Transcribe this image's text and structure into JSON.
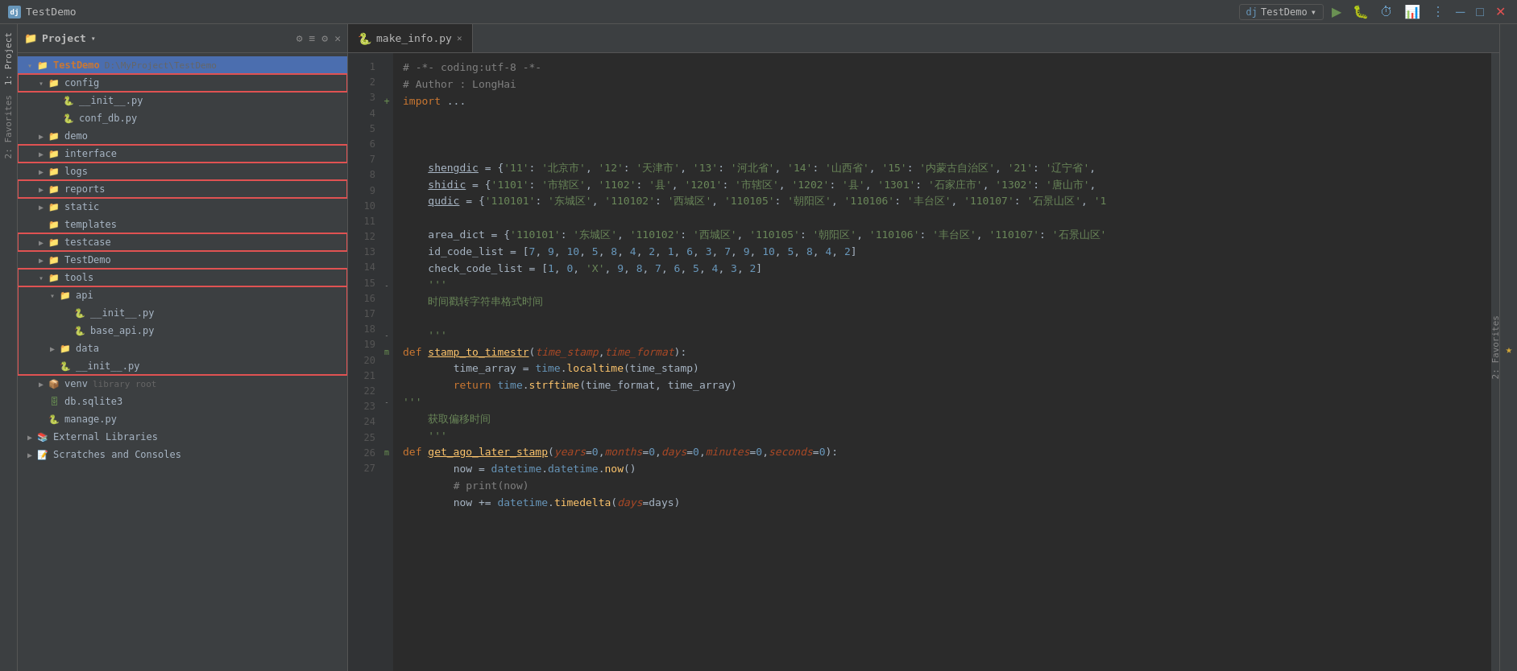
{
  "titlebar": {
    "app_name": "TestDemo",
    "run_config": "TestDemo",
    "buttons": {
      "run": "▶",
      "debug": "🐛",
      "profile": "⏱",
      "coverage": "📊",
      "more": "⋮"
    }
  },
  "project_panel": {
    "title": "Project",
    "root": {
      "name": "TestDemo",
      "path": "D:\\MyProject\\TestDemo",
      "items": [
        {
          "id": "config",
          "type": "folder",
          "label": "config",
          "indent": 1,
          "expanded": true,
          "highlighted": true
        },
        {
          "id": "init_config",
          "type": "py",
          "label": "__init__.py",
          "indent": 2
        },
        {
          "id": "conf_db",
          "type": "py",
          "label": "conf_db.py",
          "indent": 2
        },
        {
          "id": "demo",
          "type": "folder",
          "label": "demo",
          "indent": 1,
          "expanded": false
        },
        {
          "id": "interface",
          "type": "folder",
          "label": "interface",
          "indent": 1,
          "expanded": false,
          "highlighted": true
        },
        {
          "id": "logs",
          "type": "folder",
          "label": "logs",
          "indent": 1,
          "expanded": false
        },
        {
          "id": "reports",
          "type": "folder",
          "label": "reports",
          "indent": 1,
          "expanded": false,
          "highlighted": true
        },
        {
          "id": "static",
          "type": "folder",
          "label": "static",
          "indent": 1,
          "expanded": false
        },
        {
          "id": "templates",
          "type": "folder",
          "label": "templates",
          "indent": 1,
          "expanded": false
        },
        {
          "id": "testcase",
          "type": "folder",
          "label": "testcase",
          "indent": 1,
          "expanded": false,
          "highlighted": true
        },
        {
          "id": "TestDemo_pkg",
          "type": "folder",
          "label": "TestDemo",
          "indent": 1,
          "expanded": false
        },
        {
          "id": "tools",
          "type": "folder",
          "label": "tools",
          "indent": 1,
          "expanded": true,
          "highlighted": true
        },
        {
          "id": "api",
          "type": "folder",
          "label": "api",
          "indent": 2,
          "expanded": true
        },
        {
          "id": "init_api",
          "type": "py",
          "label": "__init__.py",
          "indent": 3
        },
        {
          "id": "base_api",
          "type": "py",
          "label": "base_api.py",
          "indent": 3
        },
        {
          "id": "data",
          "type": "folder",
          "label": "data",
          "indent": 2,
          "expanded": false
        },
        {
          "id": "init_tools",
          "type": "py",
          "label": "__init__.py",
          "indent": 2
        },
        {
          "id": "venv",
          "type": "venv",
          "label": "venv",
          "sublabel": "library root",
          "indent": 1,
          "expanded": false
        },
        {
          "id": "db_sqlite3",
          "type": "db",
          "label": "db.sqlite3",
          "indent": 1
        },
        {
          "id": "manage",
          "type": "py",
          "label": "manage.py",
          "indent": 1
        }
      ]
    },
    "external_libraries": "External Libraries",
    "scratches": "Scratches and Consoles"
  },
  "editor": {
    "tab_filename": "make_info.py",
    "lines": [
      {
        "num": 1,
        "content": "# -*- coding:utf-8 -*-",
        "type": "comment"
      },
      {
        "num": 2,
        "content": "# Author : LongHai",
        "type": "comment"
      },
      {
        "num": 3,
        "content": "import ...",
        "type": "import",
        "gutter": "+"
      },
      {
        "num": 4,
        "content": "",
        "type": "empty"
      },
      {
        "num": 5,
        "content": "",
        "type": "empty"
      },
      {
        "num": 6,
        "content": "",
        "type": "empty"
      },
      {
        "num": 7,
        "content": "    shengdic = {'11': '北京市', '12': '天津市', '13': '河北省', '14': '山西省', '15': '内蒙古自治区', '21': '辽宁省',",
        "type": "code"
      },
      {
        "num": 8,
        "content": "    shidic = {'1101': '市辖区', '1102': '县', '1201': '市辖区', '1202': '县', '1301': '石家庄市', '1302': '唐山市',",
        "type": "code"
      },
      {
        "num": 9,
        "content": "    qudic = {'110101': '东城区', '110102': '西城区', '110105': '朝阳区', '110106': '丰台区', '110107': '石景山区', '1",
        "type": "code"
      },
      {
        "num": 10,
        "content": "",
        "type": "empty"
      },
      {
        "num": 11,
        "content": "    area_dict = {'110101': '东城区', '110102': '西城区', '110105': '朝阳区', '110106': '丰台区', '110107': '石景山区'",
        "type": "code"
      },
      {
        "num": 12,
        "content": "    id_code_list = [7, 9, 10, 5, 8, 4, 2, 1, 6, 3, 7, 9, 10, 5, 8, 4, 2]",
        "type": "code"
      },
      {
        "num": 13,
        "content": "    check_code_list = [1, 0, 'X', 9, 8, 7, 6, 5, 4, 3, 2]",
        "type": "code"
      },
      {
        "num": 14,
        "content": "    '''",
        "type": "docstring",
        "gutter": "-"
      },
      {
        "num": 15,
        "content": "    时间戳转字符串格式时间",
        "type": "docstring"
      },
      {
        "num": 16,
        "content": "",
        "type": "empty"
      },
      {
        "num": 17,
        "content": "    '''",
        "type": "docstring",
        "gutter": "-"
      },
      {
        "num": 18,
        "content": "def stamp_to_timestr(time_stamp,time_format):",
        "type": "funcdef",
        "gutter": "m"
      },
      {
        "num": 19,
        "content": "        time_array = time.localtime(time_stamp)",
        "type": "code"
      },
      {
        "num": 20,
        "content": "        return time.strftime(time_format, time_array)",
        "type": "code"
      },
      {
        "num": 21,
        "content": "'''",
        "type": "docstring",
        "gutter": "-"
      },
      {
        "num": 22,
        "content": "    获取偏移时间",
        "type": "docstring"
      },
      {
        "num": 23,
        "content": "    '''",
        "type": "docstring"
      },
      {
        "num": 24,
        "content": "def get_ago_later_stamp(years=0,months=0,days=0,minutes=0,seconds=0):",
        "type": "funcdef",
        "gutter": "m"
      },
      {
        "num": 25,
        "content": "        now = datetime.datetime.now()",
        "type": "code"
      },
      {
        "num": 26,
        "content": "        # print(now)",
        "type": "comment"
      },
      {
        "num": 27,
        "content": "        now += datetime.timedelta(days=days)",
        "type": "code"
      }
    ]
  },
  "sidebar_left": {
    "label_project": "1: Project",
    "label_favorites": "2: Favorites"
  }
}
